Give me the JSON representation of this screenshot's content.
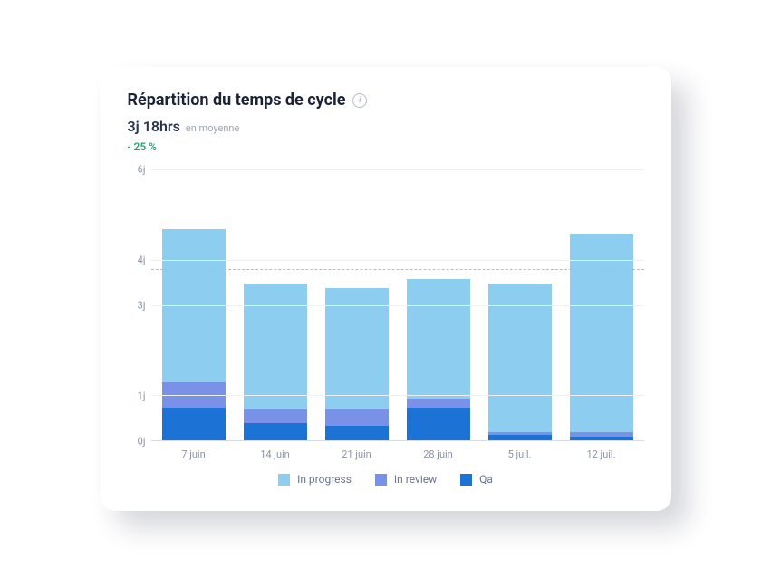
{
  "header": {
    "title": "Répartition du temps de cycle",
    "info_icon_label": "i",
    "avg_value": "3j 18hrs",
    "avg_label": "en moyenne",
    "delta": "- 25 %"
  },
  "colors": {
    "in_progress": "#8dcdf0",
    "in_review": "#7a91e8",
    "qa": "#1d72d6",
    "refline": "#f3a88e"
  },
  "chart_data": {
    "type": "bar",
    "stacked": true,
    "title": "Répartition du temps de cycle",
    "ylabel": "j",
    "ylim": [
      0,
      6
    ],
    "yticks": [
      0,
      1,
      3,
      4,
      6
    ],
    "ytick_labels": [
      "0j",
      "1j",
      "3j",
      "4j",
      "6j"
    ],
    "reference_line": 3.8,
    "categories": [
      "7 juin",
      "14 juin",
      "21 juin",
      "28 juin",
      "5 juil.",
      "12 juil."
    ],
    "series": [
      {
        "name": "Qa",
        "color": "#1d72d6",
        "values": [
          0.75,
          0.4,
          0.35,
          0.75,
          0.15,
          0.1
        ]
      },
      {
        "name": "In review",
        "color": "#7a91e8",
        "values": [
          0.55,
          0.3,
          0.35,
          0.2,
          0.05,
          0.1
        ]
      },
      {
        "name": "In progress",
        "color": "#8dcdf0",
        "values": [
          3.4,
          2.8,
          2.7,
          2.65,
          3.3,
          4.4
        ]
      }
    ],
    "legend": [
      {
        "name": "In progress",
        "color": "#8dcdf0"
      },
      {
        "name": "In review",
        "color": "#7a91e8"
      },
      {
        "name": "Qa",
        "color": "#1d72d6"
      }
    ]
  }
}
